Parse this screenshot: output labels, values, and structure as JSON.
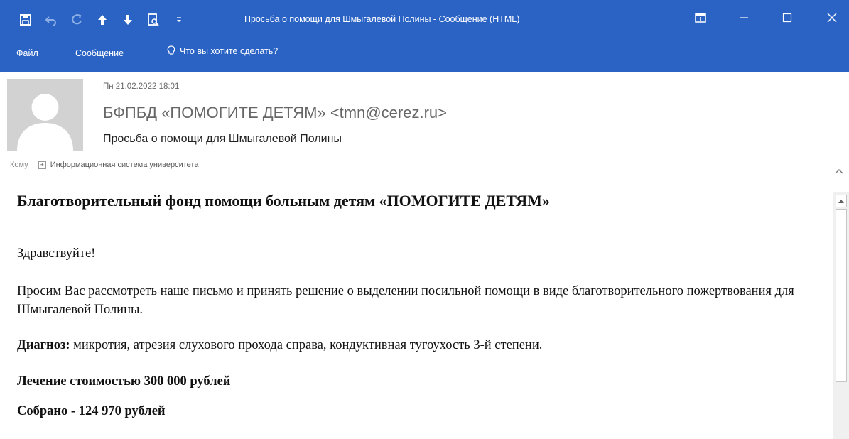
{
  "window": {
    "title": "Просьба о помощи для Шмыгалевой Полины - Сообщение (HTML)",
    "accent_color": "#2b63c4",
    "quick_access_icons": [
      "save-icon",
      "undo-icon",
      "redo-icon",
      "up-arrow-icon",
      "down-arrow-icon",
      "print-preview-icon",
      "customize-toolbar-icon"
    ],
    "controls": [
      "ribbon-display-options-icon",
      "minimize-icon",
      "maximize-icon",
      "close-icon"
    ]
  },
  "ribbon": {
    "tabs": [
      "Файл",
      "Сообщение"
    ],
    "tell_me": "Что вы хотите сделать?"
  },
  "header": {
    "date": "Пн 21.02.2022 18:01",
    "sender": "БФПБД «ПОМОГИТЕ ДЕТЯМ» <tmn@cerez.ru>",
    "subject": "Просьба о помощи для Шмыгалевой Полины",
    "to_label": "Кому",
    "recipient": "Информационная система университета"
  },
  "body": {
    "heading": "Благотворительный фонд помощи больным детям «ПОМОГИТЕ ДЕТЯМ»",
    "greeting": "Здравствуйте!",
    "request": "Просим Вас рассмотреть наше письмо и принять решение о выделении посильной помощи в виде благотворительного пожертвования для Шмыгалевой Полины.",
    "diagnosis_label": "Диагноз:",
    "diagnosis_text": " микротия, атрезия слухового прохода справа, кондуктивная тугоухость 3-й степени.",
    "cost": "Лечение стоимостью 300 000 рублей",
    "raised": "Собрано  - 124 970 рублей"
  }
}
